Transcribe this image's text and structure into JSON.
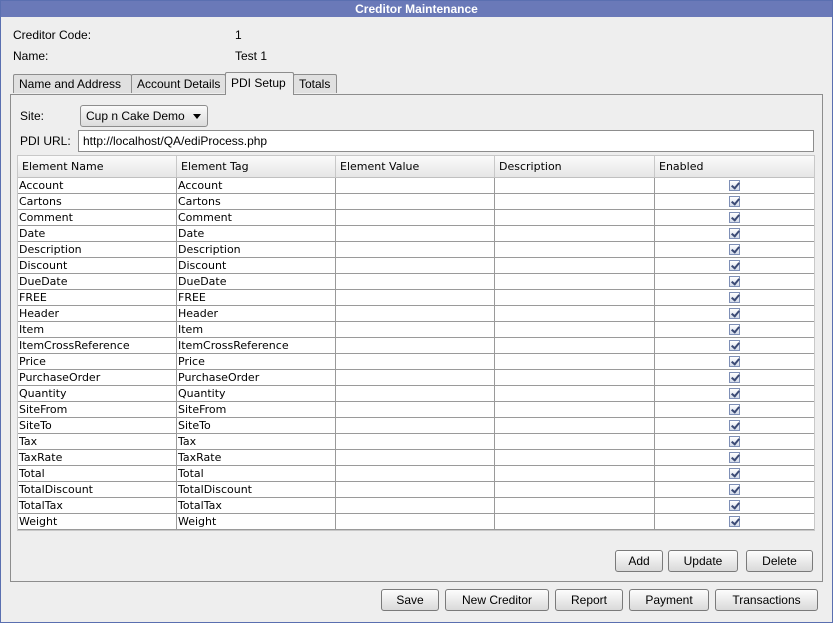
{
  "window": {
    "title": "Creditor Maintenance"
  },
  "creditor": {
    "code_label": "Creditor Code:",
    "code_value": "1",
    "name_label": "Name:",
    "name_value": "Test 1"
  },
  "tabs": [
    {
      "label": "Name and Address",
      "active": false
    },
    {
      "label": "Account Details",
      "active": false
    },
    {
      "label": "PDI Setup",
      "active": true
    },
    {
      "label": "Totals",
      "active": false
    }
  ],
  "pdi": {
    "site_label": "Site:",
    "site_value": "Cup n Cake Demo",
    "url_label": "PDI URL:",
    "url_value": "http://localhost/QA/ediProcess.php"
  },
  "table": {
    "columns": [
      "Element Name",
      "Element Tag",
      "Element Value",
      "Description",
      "Enabled"
    ],
    "rows": [
      {
        "name": "Account",
        "tag": "Account",
        "value": "",
        "description": "",
        "enabled": true
      },
      {
        "name": "Cartons",
        "tag": "Cartons",
        "value": "",
        "description": "",
        "enabled": true
      },
      {
        "name": "Comment",
        "tag": "Comment",
        "value": "",
        "description": "",
        "enabled": true
      },
      {
        "name": "Date",
        "tag": "Date",
        "value": "",
        "description": "",
        "enabled": true
      },
      {
        "name": "Description",
        "tag": "Description",
        "value": "",
        "description": "",
        "enabled": true
      },
      {
        "name": "Discount",
        "tag": "Discount",
        "value": "",
        "description": "",
        "enabled": true
      },
      {
        "name": "DueDate",
        "tag": "DueDate",
        "value": "",
        "description": "",
        "enabled": true
      },
      {
        "name": "FREE",
        "tag": "FREE",
        "value": "",
        "description": "",
        "enabled": true
      },
      {
        "name": "Header",
        "tag": "Header",
        "value": "",
        "description": "",
        "enabled": true
      },
      {
        "name": "Item",
        "tag": "Item",
        "value": "",
        "description": "",
        "enabled": true
      },
      {
        "name": "ItemCrossReference",
        "tag": "ItemCrossReference",
        "value": "",
        "description": "",
        "enabled": true
      },
      {
        "name": "Price",
        "tag": "Price",
        "value": "",
        "description": "",
        "enabled": true
      },
      {
        "name": "PurchaseOrder",
        "tag": "PurchaseOrder",
        "value": "",
        "description": "",
        "enabled": true
      },
      {
        "name": "Quantity",
        "tag": "Quantity",
        "value": "",
        "description": "",
        "enabled": true
      },
      {
        "name": "SiteFrom",
        "tag": "SiteFrom",
        "value": "",
        "description": "",
        "enabled": true
      },
      {
        "name": "SiteTo",
        "tag": "SiteTo",
        "value": "",
        "description": "",
        "enabled": true
      },
      {
        "name": "Tax",
        "tag": "Tax",
        "value": "",
        "description": "",
        "enabled": true
      },
      {
        "name": "TaxRate",
        "tag": "TaxRate",
        "value": "",
        "description": "",
        "enabled": true
      },
      {
        "name": "Total",
        "tag": "Total",
        "value": "",
        "description": "",
        "enabled": true
      },
      {
        "name": "TotalDiscount",
        "tag": "TotalDiscount",
        "value": "",
        "description": "",
        "enabled": true
      },
      {
        "name": "TotalTax",
        "tag": "TotalTax",
        "value": "",
        "description": "",
        "enabled": true
      },
      {
        "name": "Weight",
        "tag": "Weight",
        "value": "",
        "description": "",
        "enabled": true
      }
    ]
  },
  "panel_buttons": {
    "add": "Add",
    "update": "Update",
    "delete": "Delete"
  },
  "footer_buttons": {
    "save": "Save",
    "new_creditor": "New Creditor",
    "report": "Report",
    "payment": "Payment",
    "transactions": "Transactions"
  },
  "colors": {
    "title_bar": "#6a79b8",
    "background": "#eeeeee",
    "checkbox_mark": "#3b4a75"
  }
}
